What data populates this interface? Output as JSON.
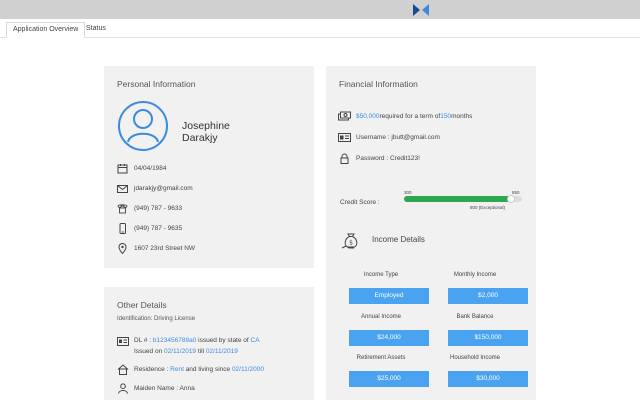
{
  "tabs": [
    {
      "label": "Application Overview"
    },
    {
      "label": "Status"
    }
  ],
  "personal": {
    "title": "Personal Information",
    "first_name": "Josephine",
    "last_name": "Darakjy",
    "dob": "04/04/1984",
    "email": "jdarakjy@gmail.com",
    "phone": "(949) 787 - 9633",
    "mobile": "(949) 787 - 9635",
    "address": "1607 23rd Street NW",
    "icons": [
      "calendar-icon",
      "email-icon",
      "telephone-icon",
      "mobile-phone-icon",
      "location-pin-icon"
    ]
  },
  "other": {
    "title": "Other Details",
    "identification": "Identification: Driving License",
    "dl_prefix": "DL # : ",
    "dl_number": "b123456789a0",
    "dl_state_text": " issued by state of ",
    "dl_state": "CA",
    "issued_on_text": "Issued on ",
    "issued_date": "02/11/2019",
    "till_text": " till ",
    "till_date": "02/11/2019",
    "residence_prefix": "Residence : ",
    "residence_type": "Rent",
    "living_since_text": " and living since ",
    "living_since": "02/11/2000",
    "maiden_name": "Maiden Name : Anna"
  },
  "financial": {
    "title": "Financial Information",
    "amount": "$50,000",
    "required_text": " required for a term of ",
    "term": "150",
    "months_text": " months",
    "username": "Username : jbutt@gmail.com",
    "password": "Password : Credit123!",
    "credit_label": "Credit Score :",
    "credit_min": "300",
    "credit_max": "850",
    "credit_value_text": "800 (Exceptional)",
    "credit_score": 800,
    "income_title": "Income Details",
    "income": [
      {
        "label": "Income Type",
        "value": "Employed"
      },
      {
        "label": "Monthly Income",
        "value": "$2,000"
      },
      {
        "label": "Annual Income",
        "value": "$24,000"
      },
      {
        "label": "Bank Balance",
        "value": "$150,000"
      },
      {
        "label": "Retirement Assets",
        "value": "$25,000"
      },
      {
        "label": "Household Income",
        "value": "$30,000"
      }
    ]
  },
  "colors": {
    "link": "#3a8be0",
    "button": "#4aa3f0",
    "credit_bar": "#2ea84f"
  }
}
